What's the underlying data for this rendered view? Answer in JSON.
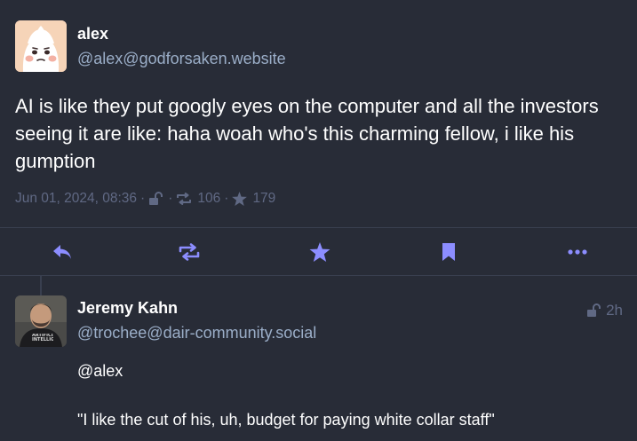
{
  "main_post": {
    "display_name": "alex",
    "acct": "@alex@godforsaken.website",
    "content": "AI is like they put googly eyes on the computer and all the investors seeing it are like: haha woah who's this charming fellow, i like his gumption",
    "timestamp": "Jun 01, 2024, 08:36",
    "separator": "·",
    "visibility_icon": "unlock-icon",
    "boost_count": "106",
    "favourite_count": "179"
  },
  "action_bar": {
    "reply_icon": "reply-icon",
    "boost_icon": "boost-icon",
    "favourite_icon": "star-icon",
    "bookmark_icon": "bookmark-icon",
    "more_icon": "ellipsis-icon"
  },
  "reply_post": {
    "display_name": "Jeremy Kahn",
    "acct": "@trochee@dair-community.social",
    "relative_time": "2h",
    "visibility_icon": "unlock-icon",
    "mention": "@alex",
    "quote": "\"I like the cut of his, uh, budget for paying white collar staff\"",
    "avatar_shirt_text": "ARTIFICIAL INTELLIGENCE"
  },
  "colors": {
    "background": "#282c37",
    "text": "#ffffff",
    "secondary": "#9baec8",
    "muted": "#606984",
    "icons": "#8c8dff"
  }
}
